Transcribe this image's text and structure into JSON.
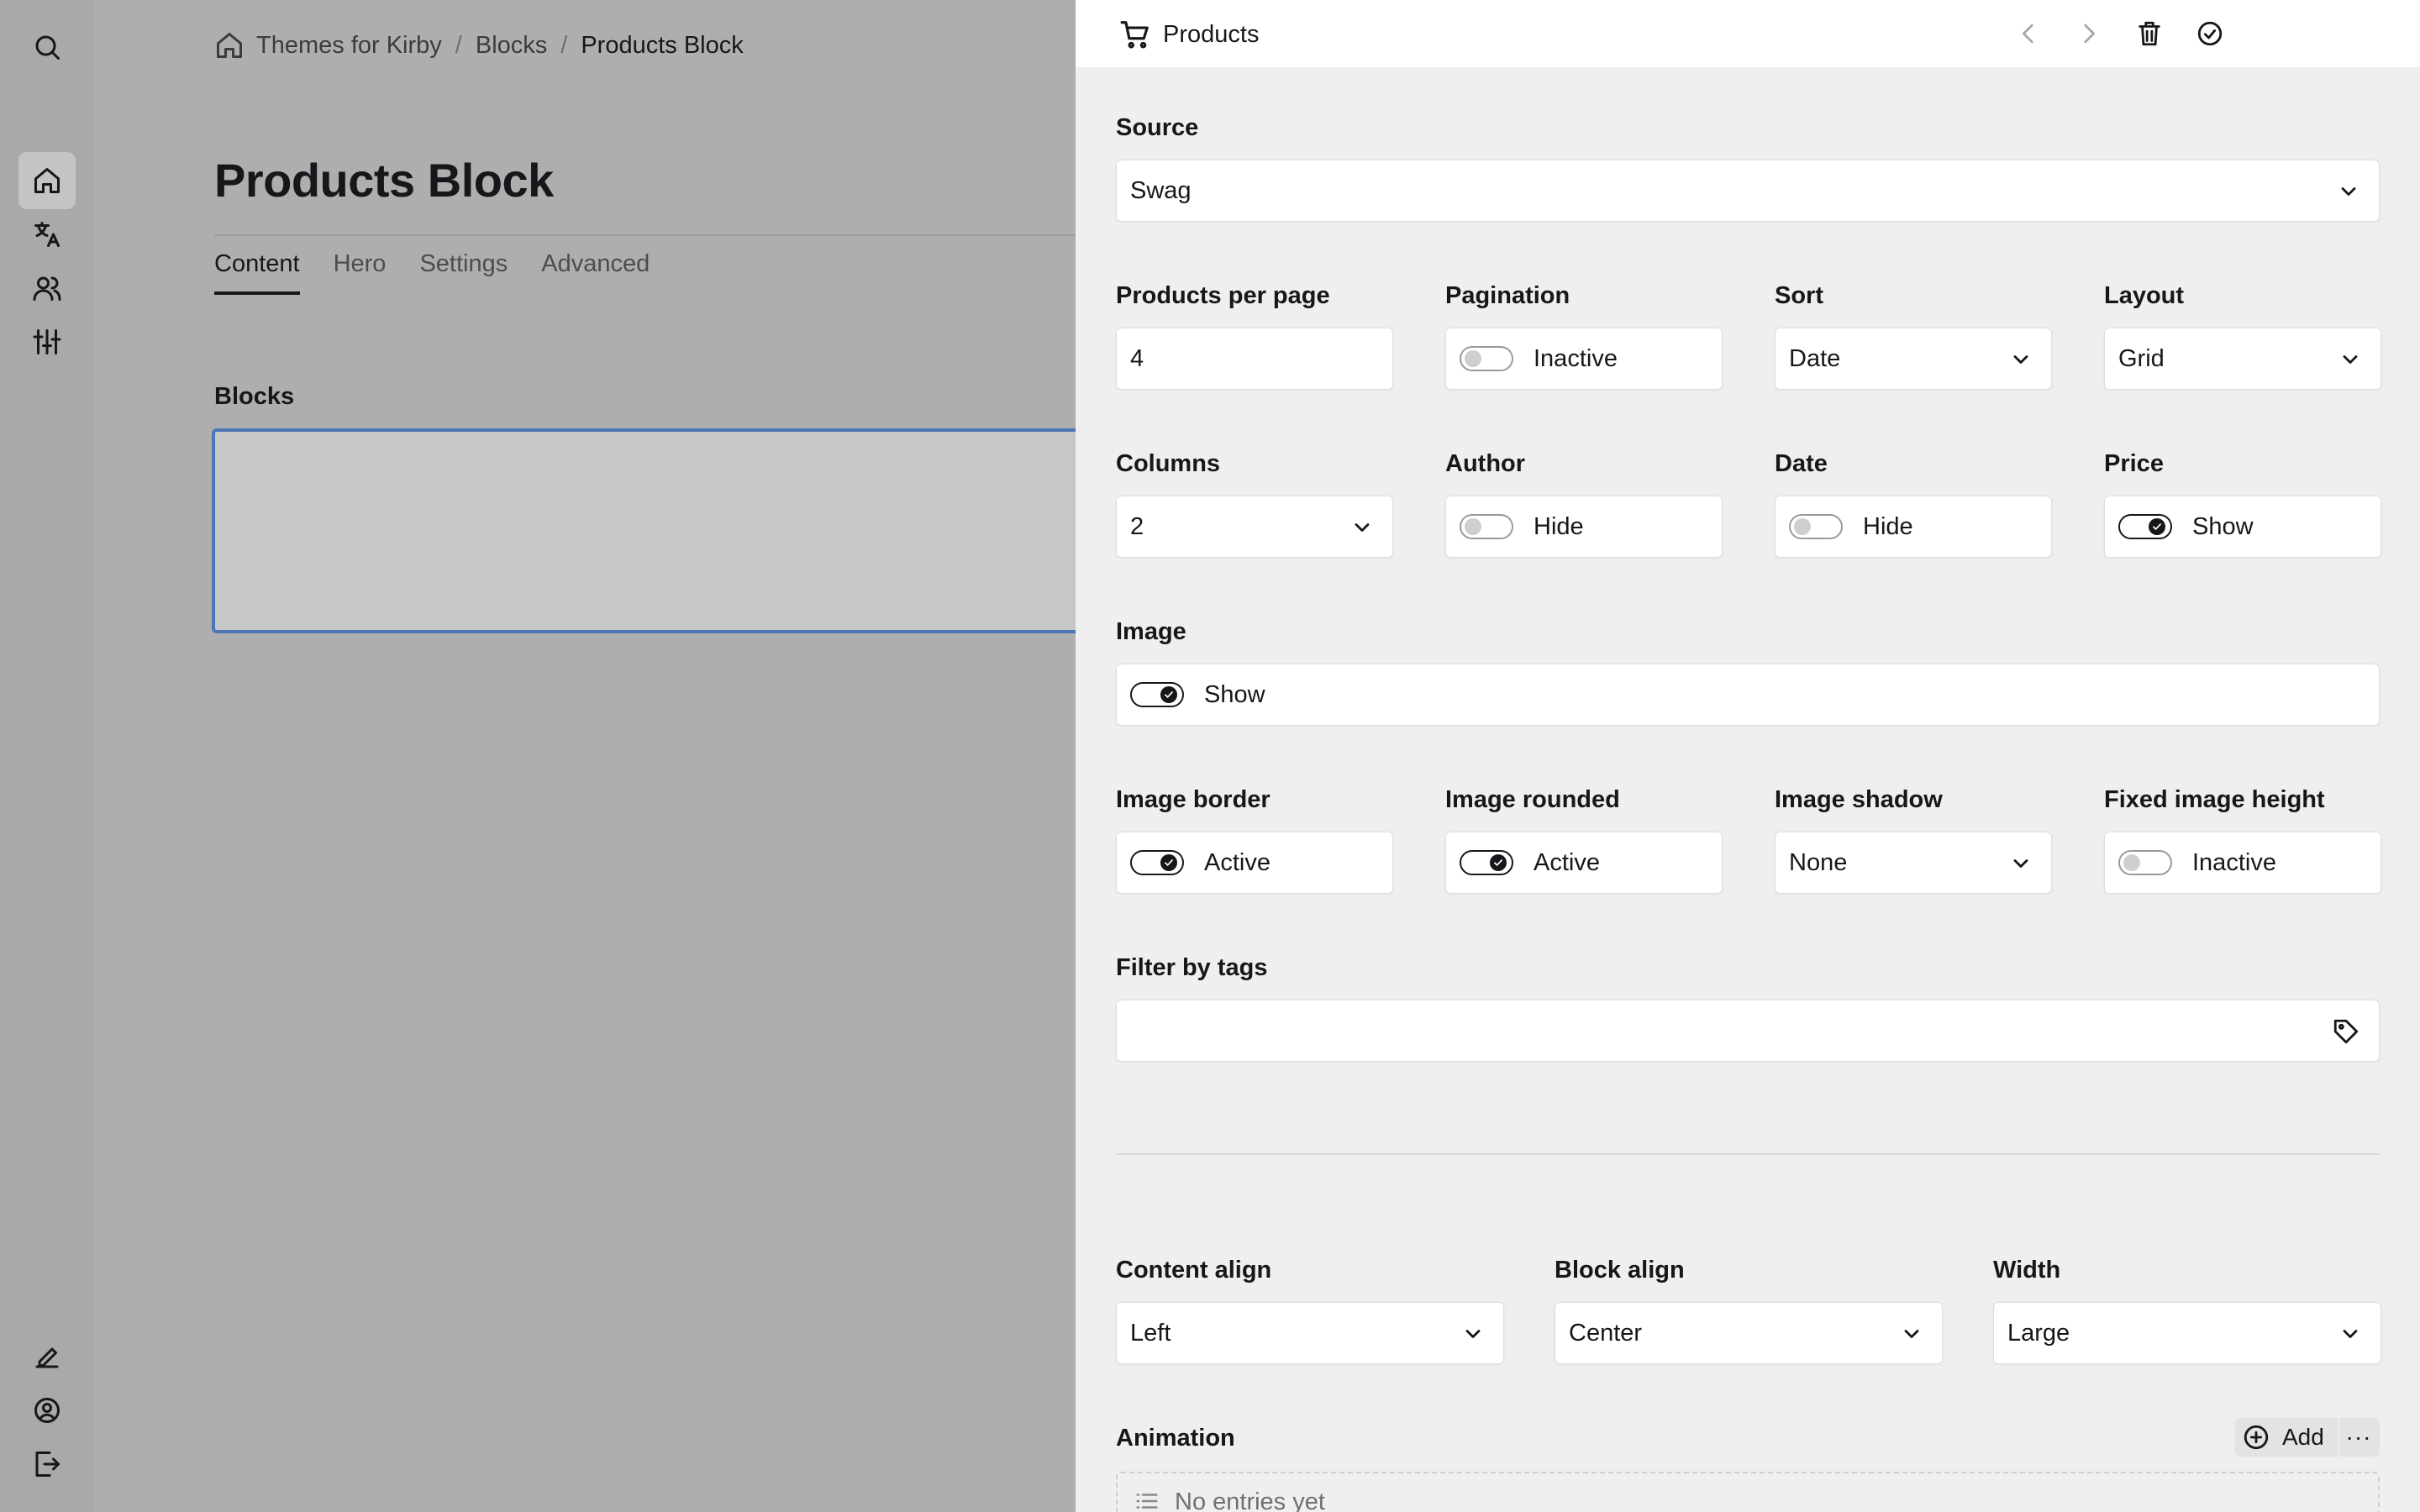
{
  "breadcrumb": {
    "items": [
      "Themes for Kirby",
      "Blocks",
      "Products Block"
    ],
    "separator": "/"
  },
  "page": {
    "title": "Products Block",
    "tabs": [
      {
        "label": "Content",
        "active": true
      },
      {
        "label": "Hero",
        "active": false
      },
      {
        "label": "Settings",
        "active": false
      },
      {
        "label": "Advanced",
        "active": false
      }
    ],
    "blocks_label": "Blocks"
  },
  "menu": {
    "top": [
      "search-icon",
      "home-icon",
      "translate-icon",
      "users-icon",
      "settings-sliders-icon"
    ],
    "bottom": [
      "edit-icon",
      "account-icon",
      "logout-icon"
    ],
    "active": "home-icon"
  },
  "drawer": {
    "title": "Products",
    "icon": "cart-icon",
    "actions": [
      "prev-icon",
      "next-icon",
      "trash-icon",
      "check-circle-icon"
    ],
    "fields": {
      "source": {
        "label": "Source",
        "value": "Swag"
      },
      "products_per_page": {
        "label": "Products per page",
        "value": "4"
      },
      "pagination": {
        "label": "Pagination",
        "value": "Inactive",
        "on": false
      },
      "sort": {
        "label": "Sort",
        "value": "Date"
      },
      "layout": {
        "label": "Layout",
        "value": "Grid"
      },
      "columns": {
        "label": "Columns",
        "value": "2"
      },
      "author": {
        "label": "Author",
        "value": "Hide",
        "on": false
      },
      "date": {
        "label": "Date",
        "value": "Hide",
        "on": false
      },
      "price": {
        "label": "Price",
        "value": "Show",
        "on": true
      },
      "image": {
        "label": "Image",
        "value": "Show",
        "on": true
      },
      "image_border": {
        "label": "Image border",
        "value": "Active",
        "on": true
      },
      "image_rounded": {
        "label": "Image rounded",
        "value": "Active",
        "on": true
      },
      "image_shadow": {
        "label": "Image shadow",
        "value": "None"
      },
      "fixed_image_height": {
        "label": "Fixed image height",
        "value": "Inactive",
        "on": false
      },
      "filter_by_tags": {
        "label": "Filter by tags",
        "value": ""
      },
      "content_align": {
        "label": "Content align",
        "value": "Left"
      },
      "block_align": {
        "label": "Block align",
        "value": "Center"
      },
      "width": {
        "label": "Width",
        "value": "Large"
      },
      "animation": {
        "label": "Animation",
        "add_label": "Add",
        "more_label": "···",
        "empty": "No entries yet"
      }
    }
  },
  "colors": {
    "focus_border": "#4d76b7",
    "drawer_bg": "#efefef",
    "input_bg": "#ffffff"
  }
}
